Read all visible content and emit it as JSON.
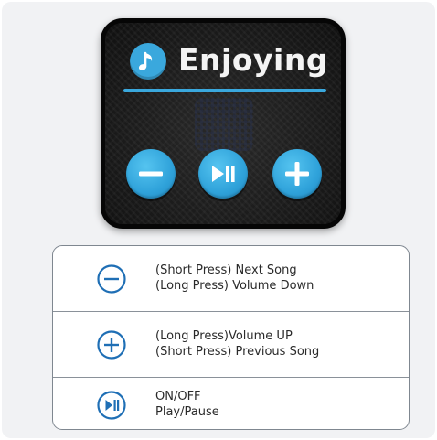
{
  "patch": {
    "title": "Enjoying",
    "icons": {
      "badge": "music-note-icon",
      "left_button": "minus-icon",
      "center_button": "play-pause-icon",
      "right_button": "plus-icon"
    },
    "colors": {
      "accent_blue": "#3aa8dd",
      "patch_black": "#161616",
      "title_white": "#f4f4f4"
    }
  },
  "legend": {
    "rows": [
      {
        "icon": "minus-circle-icon",
        "line1": "(Short Press) Next Song",
        "line2": "(Long Press) Volume Down"
      },
      {
        "icon": "plus-circle-icon",
        "line1": "(Long Press)Volume UP",
        "line2": "(Short Press) Previous Song"
      },
      {
        "icon": "play-pause-circle-icon",
        "line1": "ON/OFF",
        "line2": "Play/Pause"
      }
    ],
    "colors": {
      "icon_blue": "#1f6fb5",
      "border": "#7f8790"
    }
  }
}
